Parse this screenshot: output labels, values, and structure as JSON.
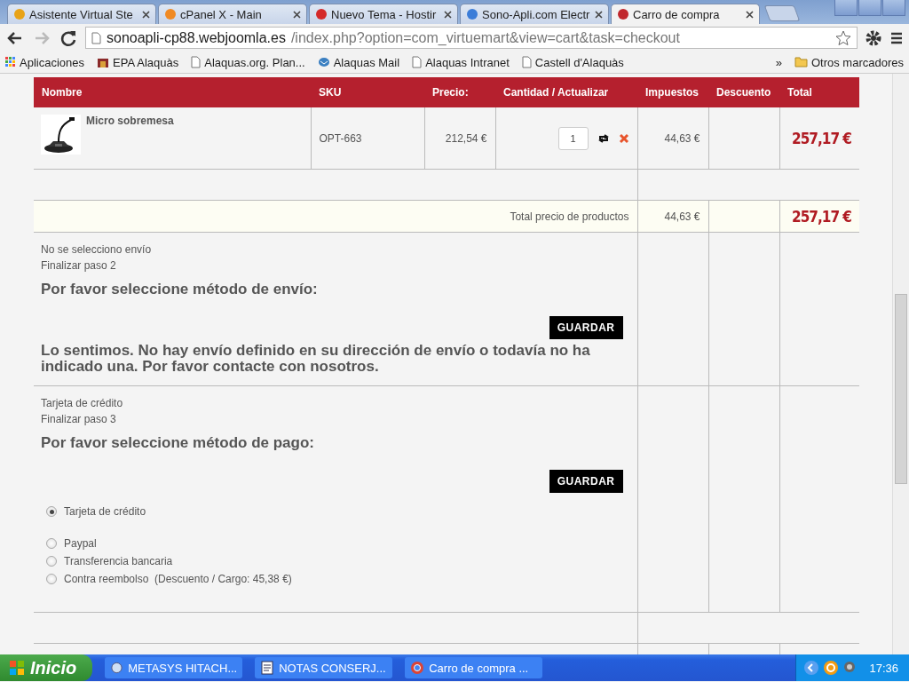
{
  "browser": {
    "tabs": [
      {
        "title": "Asistente Virtual Ste",
        "selected": false
      },
      {
        "title": "cPanel X - Main",
        "selected": false
      },
      {
        "title": "Nuevo Tema - Hostir",
        "selected": false
      },
      {
        "title": "Sono-Apli.com Electr",
        "selected": false
      },
      {
        "title": "Carro de compra",
        "selected": true
      }
    ],
    "address": {
      "host": "sonoapli-cp88.webjoomla.es",
      "path": "/index.php?option=com_virtuemart&view=cart&task=checkout"
    },
    "bookmarks": [
      {
        "label": "Aplicaciones"
      },
      {
        "label": "EPA Alaquàs"
      },
      {
        "label": "Alaquas.org. Plan..."
      },
      {
        "label": "Alaquas Mail"
      },
      {
        "label": "Alaquas Intranet"
      },
      {
        "label": "Castell d'Alaquàs"
      }
    ],
    "more": "»",
    "other_bookmarks": "Otros marcadores"
  },
  "cart": {
    "columns": [
      "Nombre",
      "SKU",
      "Precio:",
      "Cantidad / Actualizar",
      "Impuestos",
      "Descuento",
      "Total"
    ],
    "items": [
      {
        "name": "Micro sobremesa",
        "sku": "OPT-663",
        "price": "212,54 €",
        "quantity": "1",
        "tax": "44,63 €",
        "total": "257,17 €"
      }
    ],
    "total_row": {
      "label": "Total precio de productos",
      "tax": "44,63 €",
      "total": "257,17 €"
    },
    "shipping": {
      "current": "No se selecciono envío",
      "step": "Finalizar paso 2",
      "heading": "Por favor seleccione método de envío:",
      "button": "GUARDAR",
      "message": "Lo sentimos. No hay envío definido en su dirección de envío o todavía no ha indicado una. Por favor contacte con nosotros."
    },
    "payment": {
      "current": "Tarjeta de crédito",
      "step": "Finalizar paso 3",
      "heading": "Por favor seleccione método de pago:",
      "button": "GUARDAR",
      "methods": [
        {
          "label": "Tarjeta de crédito",
          "selected": true
        },
        {
          "label": "Paypal",
          "selected": false
        },
        {
          "label": "Transferencia bancaria",
          "selected": false
        },
        {
          "label": "Contra reembolso  (Descuento / Cargo: 45,38 €)",
          "selected": false
        }
      ]
    }
  },
  "taskbar": {
    "start": "Inicio",
    "tasks": [
      {
        "label": "METASYS HITACH..."
      },
      {
        "label": "NOTAS CONSERJ..."
      },
      {
        "label": "Carro de compra ..."
      }
    ],
    "time": "17:36"
  }
}
